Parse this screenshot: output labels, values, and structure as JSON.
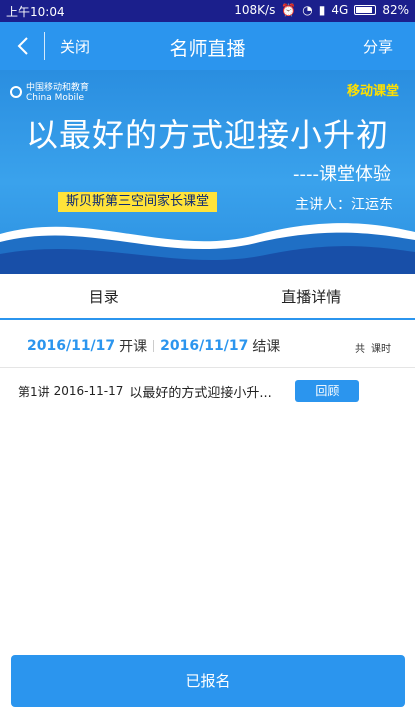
{
  "status_bar": {
    "time": "上午10:04",
    "net_speed": "108K/s",
    "network": "4G",
    "battery": "82%"
  },
  "nav": {
    "close_label": "关闭",
    "title": "名师直播",
    "share_label": "分享"
  },
  "banner": {
    "brand_left": "中国移动",
    "brand_left_en": "China Mobile",
    "brand_edu": "和教育",
    "tag": "移动课堂",
    "headline": "以最好的方式迎接小升初",
    "subline": "----课堂体验",
    "ribbon": "斯贝斯第三空间家长课堂",
    "speaker": "主讲人：江运东"
  },
  "tabs": [
    "目录",
    "直播详情"
  ],
  "schedule": {
    "start_date": "2016/11/17",
    "start_label": "开课",
    "end_date": "2016/11/17",
    "end_label": "结课",
    "total_prefix": "共",
    "total_suffix": "课时"
  },
  "lessons": [
    {
      "num": "第1讲",
      "date": "2016-11-17",
      "title": "以最好的方式迎接小升...",
      "action": "回顾"
    }
  ],
  "footer": {
    "enroll_label": "已报名"
  },
  "colors": {
    "accent": "#2b95ee",
    "status_bar": "#1b1f8c",
    "ribbon": "#ffe33a"
  }
}
